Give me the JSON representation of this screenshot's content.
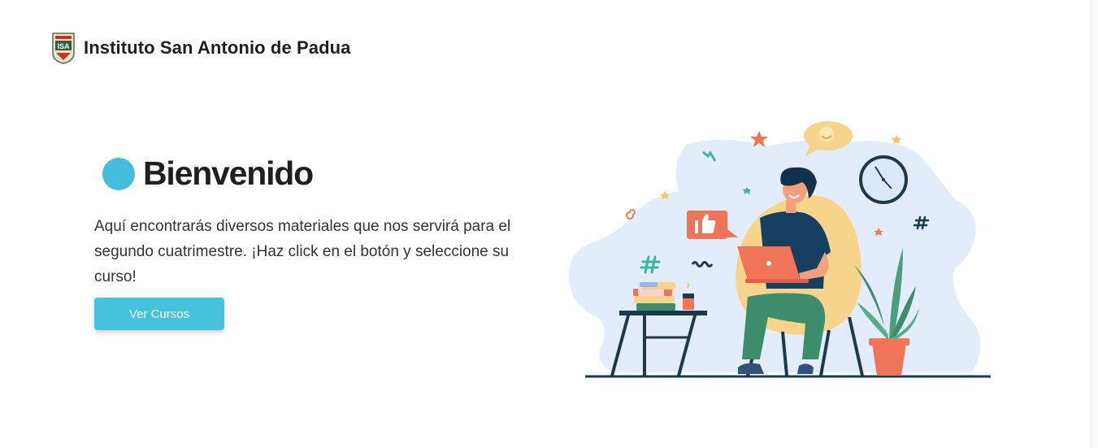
{
  "navbar": {
    "brand_name": "Instituto San Antonio de Padua",
    "logo_text": "ISA"
  },
  "hero": {
    "title": "Bienvenido",
    "description": "Aquí encontrarás diversos materiales que nos servirá para el segundo cuatrimestre. ¡Haz click en el botón y seleccione su curso!",
    "button_label": "Ver Cursos"
  },
  "colors": {
    "accent": "#45c3dc",
    "title_dot": "#45bedb",
    "blob": "#e3ecfb",
    "navy": "#1c3a4f",
    "coral": "#f07457",
    "yellow": "#f6d48b",
    "green": "#3d8c6b"
  },
  "illustration": {
    "icons": [
      "clock-icon",
      "thumbs-up-icon",
      "smiley-chat-icon",
      "hashtag-icon",
      "star-icon",
      "plant-icon",
      "laptop-icon",
      "book-stack-icon"
    ]
  }
}
